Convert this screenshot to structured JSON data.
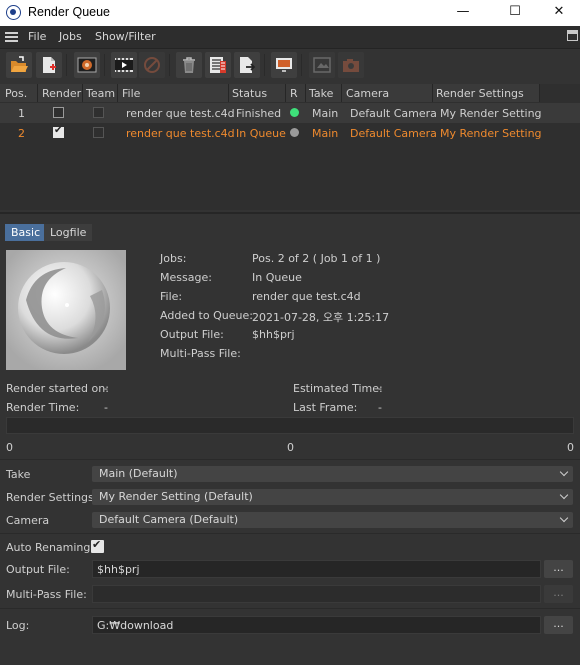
{
  "window": {
    "title": "Render Queue",
    "minimize": "—",
    "maximize": "☐",
    "close": "✕"
  },
  "menu": [
    "File",
    "Jobs",
    "Show/Filter"
  ],
  "toolbar": [
    {
      "name": "open-icon",
      "disabled": false
    },
    {
      "name": "new-job-icon",
      "disabled": false
    },
    {
      "name": "picture-viewer-icon",
      "disabled": false
    },
    {
      "name": "start-render-icon",
      "disabled": false
    },
    {
      "name": "stop-render-icon",
      "disabled": true
    },
    {
      "name": "delete-icon",
      "disabled": false
    },
    {
      "name": "render-settings-icon",
      "disabled": false
    },
    {
      "name": "export-icon",
      "disabled": false
    },
    {
      "name": "display-icon",
      "disabled": false
    },
    {
      "name": "view-icon",
      "disabled": true
    },
    {
      "name": "camera-icon",
      "disabled": true
    }
  ],
  "queue": {
    "headers": [
      "Pos.",
      "Render",
      "Team",
      "File",
      "Status",
      "R",
      "Take",
      "Camera",
      "Render Settings"
    ],
    "rows": [
      {
        "pos": "1",
        "render": false,
        "team": false,
        "file": "render que test.c4d",
        "status": "Finished",
        "r_color": "#3ee07a",
        "take": "Main",
        "camera": "Default Camera",
        "settings": "My Render Setting",
        "color": "#cfcfcf",
        "bg": "#3a3a3a"
      },
      {
        "pos": "2",
        "render": true,
        "team": false,
        "file": "render que test.c4d",
        "status": "In Queue",
        "r_color": "#9a9a9a",
        "take": "Main",
        "camera": "Default Camera",
        "settings": "My Render Setting",
        "color": "#ef8a2e",
        "bg": "#2f2f2f"
      }
    ]
  },
  "tabs": {
    "basic": "Basic",
    "logfile": "Logfile"
  },
  "info": {
    "jobs_label": "Jobs:",
    "jobs_value": "Pos. 2 of 2 ( Job 1 of 1 )",
    "message_label": "Message:",
    "message_value": "In Queue",
    "file_label": "File:",
    "file_value": "render que test.c4d",
    "added_label": "Added to Queue:",
    "added_value": "2021-07-28, 오후 1:25:17",
    "output_label": "Output File:",
    "output_value": "$hh$prj",
    "multipass_label": "Multi-Pass File:",
    "multipass_value": ""
  },
  "stats": {
    "started_label": "Render started on:",
    "started_value": "-",
    "estimated_label": "Estimated Time:",
    "estimated_value": "-",
    "time_label": "Render Time:",
    "time_value": "-",
    "lastframe_label": "Last Frame:",
    "lastframe_value": "-"
  },
  "progress": {
    "left": "0",
    "middle": "0",
    "right": "0"
  },
  "settings": {
    "take_label": "Take",
    "take_value": "Main (Default)",
    "rs_label": "Render Settings",
    "rs_value": "My Render Setting (Default)",
    "camera_label": "Camera",
    "camera_value": "Default Camera (Default)",
    "auto_label": "Auto Renaming",
    "output_label": "Output File:",
    "output_value": "$hh$prj",
    "multipass_label": "Multi-Pass File:",
    "multipass_value": "",
    "log_label": "Log:",
    "log_value": "G:₩download",
    "browse": "..."
  }
}
